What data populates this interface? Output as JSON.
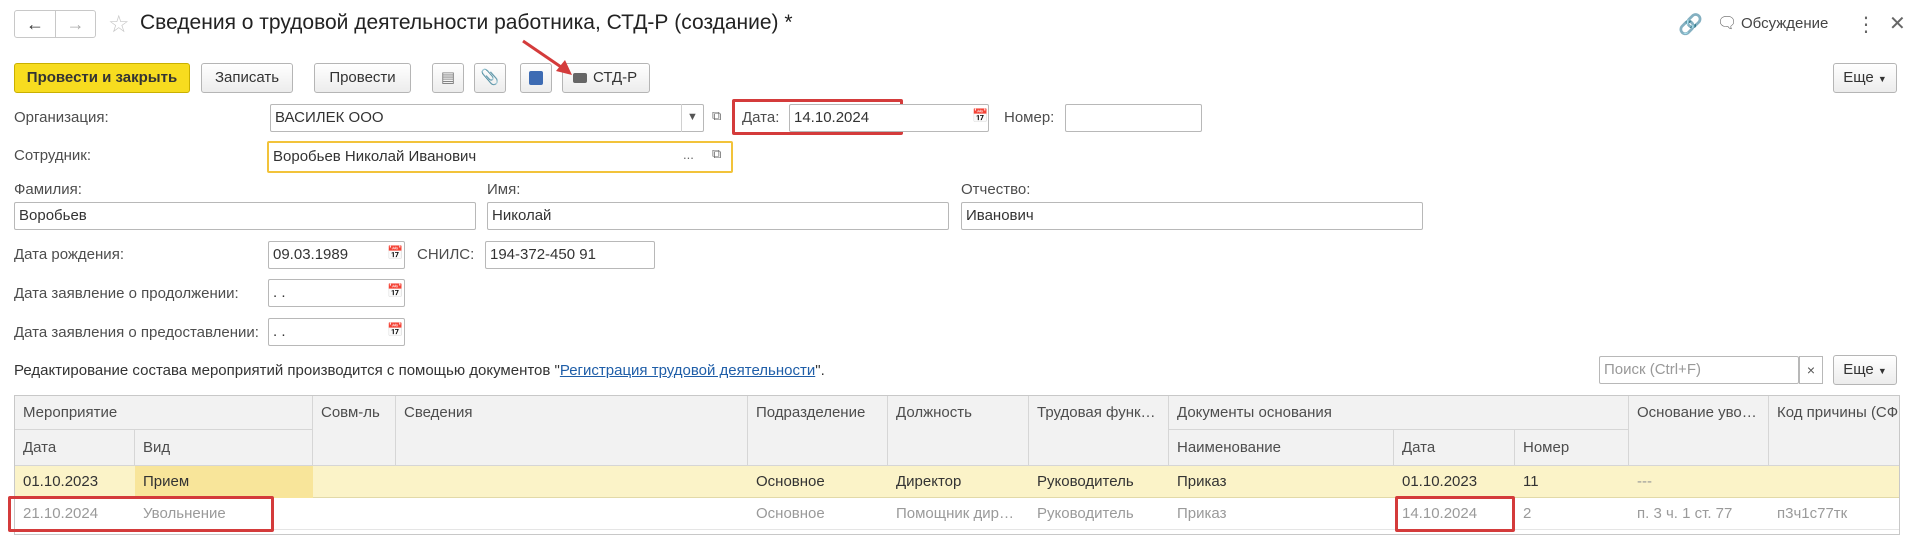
{
  "window": {
    "title": "Сведения о трудовой деятельности работника, СТД-Р (создание) *",
    "discussion_label": "Обсуждение"
  },
  "toolbar": {
    "post_close_label": "Провести и закрыть",
    "save_label": "Записать",
    "post_label": "Провести",
    "print_label": "СТД-Р",
    "more_label": "Еще"
  },
  "form": {
    "org_label": "Организация:",
    "org_value": "ВАСИЛЕК ООО",
    "date_label": "Дата:",
    "date_value": "14.10.2024",
    "number_label": "Номер:",
    "number_value": "",
    "employee_label": "Сотрудник:",
    "employee_value": "Воробьев Николай Иванович",
    "lastname_label": "Фамилия:",
    "lastname_value": "Воробьев",
    "firstname_label": "Имя:",
    "firstname_value": "Николай",
    "patronymic_label": "Отчество:",
    "patronymic_value": "Иванович",
    "birthdate_label": "Дата рождения:",
    "birthdate_value": "09.03.1989",
    "snils_label": "СНИЛС:",
    "snils_value": "194-372-450 91",
    "continue_date_label": "Дата заявление о продолжении:",
    "continue_date_value": " .  .",
    "provide_date_label": "Дата заявления о предоставлении:",
    "provide_date_value": " .  ."
  },
  "info": {
    "text_before": "Редактирование состава мероприятий производится с помощью документов \"",
    "link": "Регистрация трудовой деятельности",
    "text_after": "\"."
  },
  "search": {
    "placeholder": "Поиск (Ctrl+F)",
    "clear": "×",
    "more_label": "Еще"
  },
  "table": {
    "headers": {
      "event": "Мероприятие",
      "date": "Дата",
      "kind": "Вид",
      "combo": "Совм-ль",
      "details": "Сведения",
      "division": "Подразделение",
      "position": "Должность",
      "labor_func": "Трудовая функ…",
      "docs": "Документы основания",
      "doc_name": "Наименование",
      "doc_date": "Дата",
      "doc_number": "Номер",
      "dismiss_reason": "Основание уво…",
      "reason_code": "Код причины (СФ…"
    },
    "rows": [
      {
        "date": "01.10.2023",
        "kind": "Прием",
        "combo": "",
        "details": "",
        "division": "Основное",
        "position": "Директор",
        "labor_func": "Руководитель",
        "doc_name": "Приказ",
        "doc_date": "01.10.2023",
        "doc_number": "11",
        "dismiss_reason": "---",
        "reason_code": ""
      },
      {
        "date": "21.10.2024",
        "kind": "Увольнение",
        "combo": "",
        "details": "",
        "division": "Основное",
        "position": "Помощник дир…",
        "labor_func": "Руководитель",
        "doc_name": "Приказ",
        "doc_date": "14.10.2024",
        "doc_number": "2",
        "dismiss_reason": "п. 3 ч. 1 ст. 77",
        "reason_code": "п3ч1с77тк"
      }
    ]
  },
  "colors": {
    "accent": "#f7dc1f",
    "highlight_row": "#fbf3c8",
    "annotation": "#d43b3b"
  }
}
